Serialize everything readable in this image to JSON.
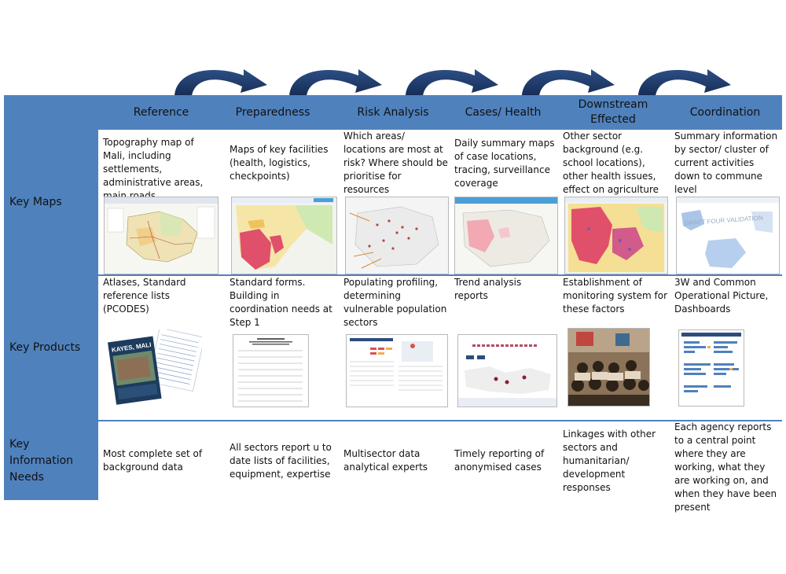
{
  "columns": [
    "Reference",
    "Preparedness",
    "Risk Analysis",
    "Cases/ Health",
    "Downstream\nEffected",
    "Coordination"
  ],
  "rows": [
    {
      "label": "Key Maps",
      "cells": [
        "Topography map of Mali, including settlements, administrative areas, main roads",
        "Maps of key facilities (health, logistics, checkpoints)",
        "Which areas/ locations are most at risk? Where should be prioritise for resources",
        "Daily summary maps of case locations, tracing, surveillance coverage",
        "Other sector background (e.g. school locations), other health issues, effect on agriculture",
        "Summary information by sector/ cluster of current activities down to commune level"
      ]
    },
    {
      "label": "Key Products",
      "cells": [
        "Atlases, Standard reference lists (PCODES)",
        "Standard forms. Building in coordination needs at Step 1",
        "Populating profiling, determining vulnerable population sectors",
        "Trend analysis reports",
        "Establishment of monitoring system for these factors",
        "3W and Common Operational Picture, Dashboards"
      ]
    },
    {
      "label": "Key Information Needs",
      "cells": [
        "Most complete set of background data",
        "All sectors report u to date lists of facilities, equipment, expertise",
        "Multisector data analytical experts",
        "Timely reporting of anonymised cases",
        "Linkages with other sectors and humanitarian/ development responses",
        "Each agency reports to a central point where they are working, what they are working on, and when they have been present"
      ]
    }
  ],
  "thumbnails": {
    "map_1_stamp": "DRAFT FOUR VALIDATION",
    "product_0_cover": "KAYES, MALI"
  },
  "colors": {
    "accent_blue": "#4f81bd",
    "arrow_navy": "#1f3864",
    "risk_red": "#e0506a",
    "map_yellow": "#f3d98a",
    "map_green": "#bfe3a0"
  },
  "icons": [
    "curved-arrow-icon"
  ]
}
